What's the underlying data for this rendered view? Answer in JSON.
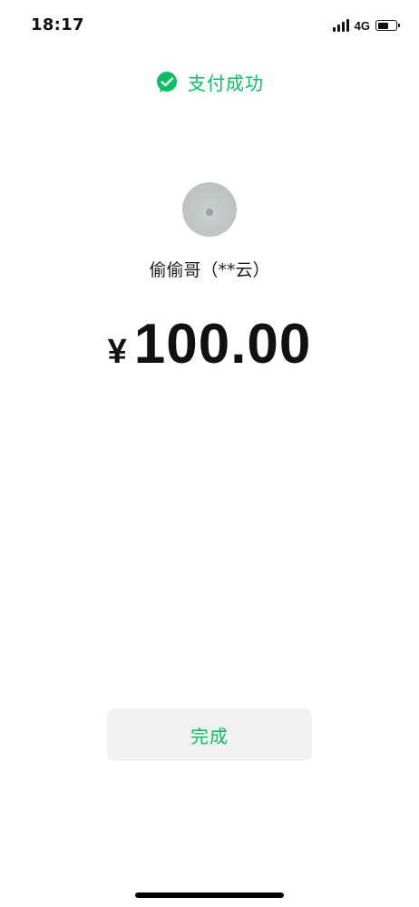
{
  "status_bar": {
    "time": "18:17",
    "network": "4G",
    "battery_level": 0.6,
    "signal_bars": 4
  },
  "header": {
    "title": "支付成功",
    "icon": "wechat-pay-check-icon",
    "accent_color": "#07c160"
  },
  "payee": {
    "name": "偷偷哥（**云）"
  },
  "amount": {
    "currency_symbol": "¥",
    "value": "100.00"
  },
  "actions": {
    "done_label": "完成"
  }
}
